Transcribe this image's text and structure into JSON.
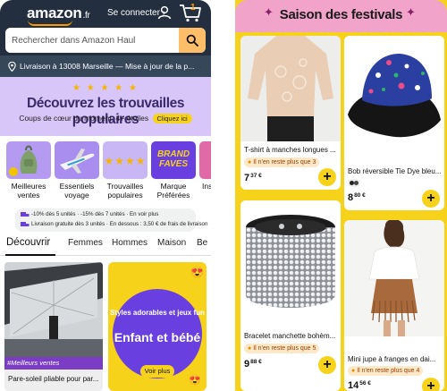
{
  "left": {
    "header": {
      "logo": "amazon",
      "logo_suffix": ".fr",
      "signin_label": "Se connecter ›",
      "cart_count": "1"
    },
    "search": {
      "placeholder": "Rechercher dans Amazon Haul"
    },
    "delivery": {
      "text": "Livraison à 13008 Marseille — Mise à jour de la p..."
    },
    "banner": {
      "stars": "★ ★ ★ ★ ★",
      "title": "Découvrez les trouvailles populaires",
      "subtitle": "Coups de cœur du moment, 4+ étoiles",
      "cta": "Cliquez ici",
      "background": "#d7c6f7"
    },
    "categories": [
      {
        "label": "Meilleures ventes"
      },
      {
        "label": "Essentiels voyage"
      },
      {
        "label": "Trouvailles populaires"
      },
      {
        "label": "Marque Préférées",
        "tile_text": "BRAND FAVES"
      },
      {
        "label": "Ins"
      }
    ],
    "promo": {
      "line1": "-10% dès 5 unités · -15% dès 7 unités · En voir plus",
      "line2": "Livraison gratuite dès 3 unités · En dessous : 3,50 € de frais de livraison"
    },
    "tabs": [
      "Découvrir",
      "Femmes",
      "Hommes",
      "Maison",
      "Be"
    ],
    "cards": {
      "car": {
        "badge": "#Meilleurs ventes",
        "title": "Pare-soleil pliable pour par..."
      },
      "kids": {
        "subtitle": "Styles adorables et jeux fun",
        "title": "Enfant et bébé",
        "cta": "Voir plus"
      }
    }
  },
  "right": {
    "header": {
      "title": "Saison des festivals",
      "background": "#f1a3c9"
    },
    "products": [
      {
        "title": "T-shirt à manches longues ...",
        "badge": "Il n'en reste plus que 3",
        "price_main": "7",
        "price_cents": "37 €"
      },
      {
        "title": "Bob réversible Tie Dye bleu...",
        "price_main": "8",
        "price_cents": "80 €"
      },
      {
        "title": "Bracelet manchette bohèm...",
        "badge": "Il n'en reste plus que 5",
        "price_main": "9",
        "price_cents": "88 €"
      },
      {
        "title": "Mini jupe à franges en dai...",
        "badge": "Il n'en reste plus que 4",
        "price_main": "14",
        "price_cents": "56 €"
      }
    ],
    "add_label": "+"
  },
  "colors": {
    "amazon_navy": "#232f3e",
    "amazon_orange": "#ff9900",
    "accent_yellow": "#f7d21a",
    "purple": "#6a3fe0"
  }
}
